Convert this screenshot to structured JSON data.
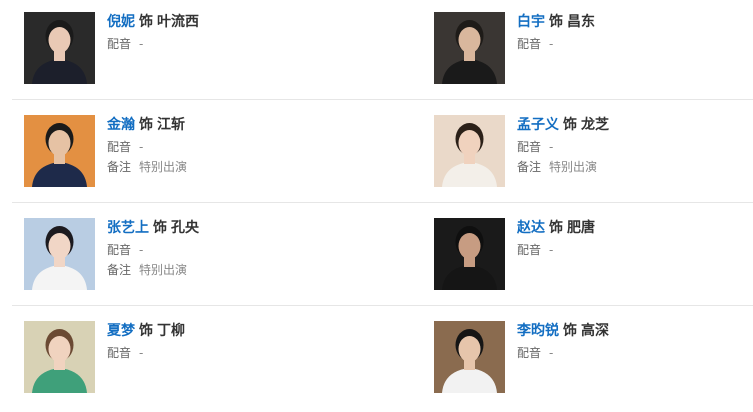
{
  "cast": [
    {
      "actor": "倪妮",
      "as": "饰",
      "role": "叶流西",
      "dub_label": "配音",
      "dub_value": "-",
      "bg": "#2a2a2a",
      "tone": "#e9c9b5",
      "hair": "#1a1a1a",
      "cloth": "#1c1f2b"
    },
    {
      "actor": "白宇",
      "as": "饰",
      "role": "昌东",
      "dub_label": "配音",
      "dub_value": "-",
      "bg": "#3a3633",
      "tone": "#d9b79d",
      "hair": "#1e1b18",
      "cloth": "#1a1a1a"
    },
    {
      "actor": "金瀚",
      "as": "饰",
      "role": "江斩",
      "dub_label": "配音",
      "dub_value": "-",
      "note_label": "备注",
      "note_value": "特别出演",
      "bg": "#e39042",
      "tone": "#e6c2a4",
      "hair": "#1a1a1a",
      "cloth": "#1e2a4a"
    },
    {
      "actor": "孟子义",
      "as": "饰",
      "role": "龙芝",
      "dub_label": "配音",
      "dub_value": "-",
      "note_label": "备注",
      "note_value": "特别出演",
      "bg": "#ead9c9",
      "tone": "#f0d2be",
      "hair": "#2b2018",
      "cloth": "#f3efe9"
    },
    {
      "actor": "张艺上",
      "as": "饰",
      "role": "孔央",
      "dub_label": "配音",
      "dub_value": "-",
      "note_label": "备注",
      "note_value": "特别出演",
      "bg": "#b9cde3",
      "tone": "#f1d6c6",
      "hair": "#1c1a1f",
      "cloth": "#f4f4f4"
    },
    {
      "actor": "赵达",
      "as": "饰",
      "role": "肥唐",
      "dub_label": "配音",
      "dub_value": "-",
      "bg": "#1a1a1a",
      "tone": "#c79c82",
      "hair": "#0f0f0f",
      "cloth": "#151515"
    },
    {
      "actor": "夏梦",
      "as": "饰",
      "role": "丁柳",
      "dub_label": "配音",
      "dub_value": "-",
      "bg": "#d8d2b5",
      "tone": "#f0d3bf",
      "hair": "#6b4a33",
      "cloth": "#3fa07a"
    },
    {
      "actor": "李昀锐",
      "as": "饰",
      "role": "高深",
      "dub_label": "配音",
      "dub_value": "-",
      "bg": "#8a6b4f",
      "tone": "#e6c5ab",
      "hair": "#151515",
      "cloth": "#f2f2f2"
    }
  ]
}
